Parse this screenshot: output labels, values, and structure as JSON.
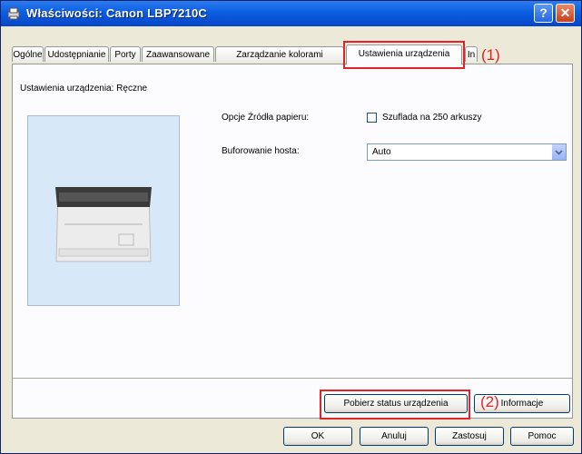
{
  "window": {
    "title": "Właściwości: Canon LBP7210C",
    "help_label": "?",
    "close_label": "✕"
  },
  "tabs": [
    {
      "label": "Ogólne"
    },
    {
      "label": "Udostępnianie"
    },
    {
      "label": "Porty"
    },
    {
      "label": "Zaawansowane"
    },
    {
      "label": "Zarządzanie kolorami"
    },
    {
      "label": "Ustawienia urządzenia"
    },
    {
      "label": "In"
    }
  ],
  "panel": {
    "section_label": "Ustawienia urządzenia: Ręczne",
    "paper_source_label": "Opcje Źródła papieru:",
    "paper_source_option": "Szuflada na 250 arkuszy",
    "paper_source_checked": false,
    "host_spooling_label": "Buforowanie hosta:",
    "host_spooling_value": "Auto",
    "get_status_button": "Pobierz status urządzenia",
    "info_button": "Informacje"
  },
  "footer": {
    "ok": "OK",
    "cancel": "Anuluj",
    "apply": "Zastosuj",
    "help": "Pomoc"
  },
  "callouts": {
    "one": "(1)",
    "two": "(2)",
    "color": "#e4222a"
  }
}
